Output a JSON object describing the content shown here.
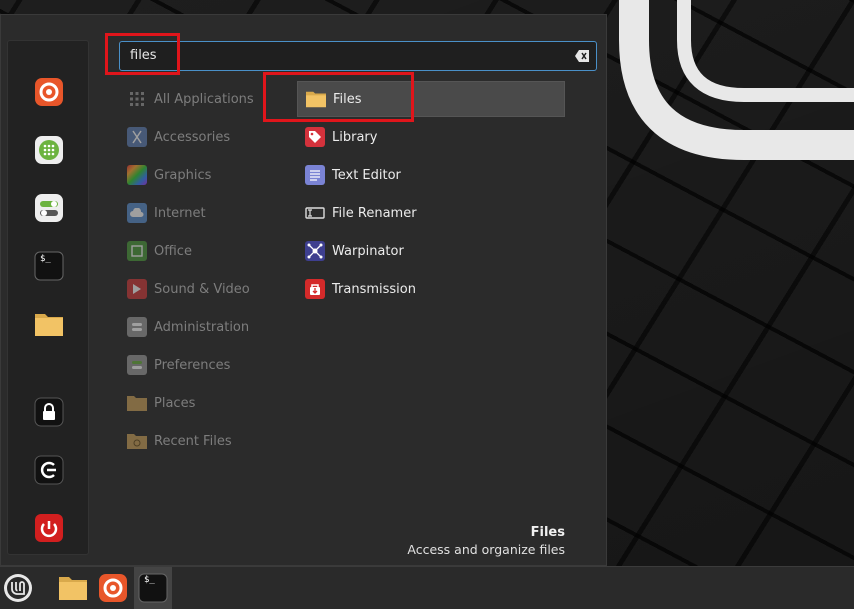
{
  "search": {
    "query": "files",
    "clear_icon": "clear-text-icon"
  },
  "favorites": [
    {
      "name": "firefox",
      "icon": "firefox-icon"
    },
    {
      "name": "software-manager",
      "icon": "grid-icon"
    },
    {
      "name": "settings",
      "icon": "toggle-icon"
    },
    {
      "name": "terminal",
      "icon": "terminal-icon",
      "glyph": "$_"
    },
    {
      "name": "files",
      "icon": "folder-icon"
    },
    {
      "name": "lock",
      "icon": "lock-icon"
    },
    {
      "name": "logout",
      "icon": "logout-icon"
    },
    {
      "name": "shutdown",
      "icon": "power-icon"
    }
  ],
  "categories": [
    {
      "label": "All Applications"
    },
    {
      "label": "Accessories"
    },
    {
      "label": "Graphics"
    },
    {
      "label": "Internet"
    },
    {
      "label": "Office"
    },
    {
      "label": "Sound & Video"
    },
    {
      "label": "Administration"
    },
    {
      "label": "Preferences"
    },
    {
      "label": "Places"
    },
    {
      "label": "Recent Files"
    }
  ],
  "results": [
    {
      "label": "Files",
      "selected": true
    },
    {
      "label": "Library"
    },
    {
      "label": "Text Editor"
    },
    {
      "label": "File Renamer"
    },
    {
      "label": "Warpinator"
    },
    {
      "label": "Transmission"
    }
  ],
  "description": {
    "title": "Files",
    "text": "Access and organize files"
  },
  "taskbar": {
    "menu_icon": "mint-menu-icon",
    "launchers": [
      {
        "icon": "folder-icon"
      },
      {
        "icon": "firefox-icon"
      },
      {
        "icon": "terminal-icon",
        "glyph": "$_"
      }
    ]
  },
  "colors": {
    "highlight": "#e0151b",
    "search_border": "#4a90c8",
    "selection": "#4a4a4a"
  }
}
